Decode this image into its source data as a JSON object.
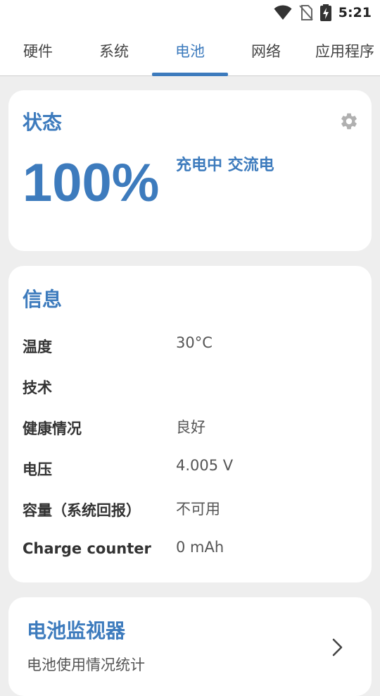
{
  "status_bar": {
    "time": "5:21",
    "icons": [
      "wifi-icon",
      "no-sim-icon",
      "battery-charging-icon"
    ]
  },
  "tabs": [
    {
      "label": "硬件",
      "active": false
    },
    {
      "label": "系统",
      "active": false
    },
    {
      "label": "电池",
      "active": true
    },
    {
      "label": "网络",
      "active": false
    },
    {
      "label": "应用程序",
      "active": false
    }
  ],
  "status_card": {
    "title": "状态",
    "percent": "100%",
    "charging_text": "充电中 交流电",
    "settings_icon": "gear-icon"
  },
  "info_card": {
    "title": "信息",
    "rows": [
      {
        "label": "温度",
        "value": "30°C"
      },
      {
        "label": "技术",
        "value": ""
      },
      {
        "label": "健康情况",
        "value": "良好"
      },
      {
        "label": "电压",
        "value": "4.005 V"
      },
      {
        "label": "容量（系统回报）",
        "value": "不可用"
      },
      {
        "label": "Charge counter",
        "value": "0 mAh"
      }
    ]
  },
  "monitor_card": {
    "title": "电池监视器",
    "subtitle": "电池使用情况统计",
    "chevron_icon": "chevron-right-icon"
  },
  "colors": {
    "accent": "#3d7bbd",
    "background": "#eeeeee",
    "card": "#ffffff"
  }
}
